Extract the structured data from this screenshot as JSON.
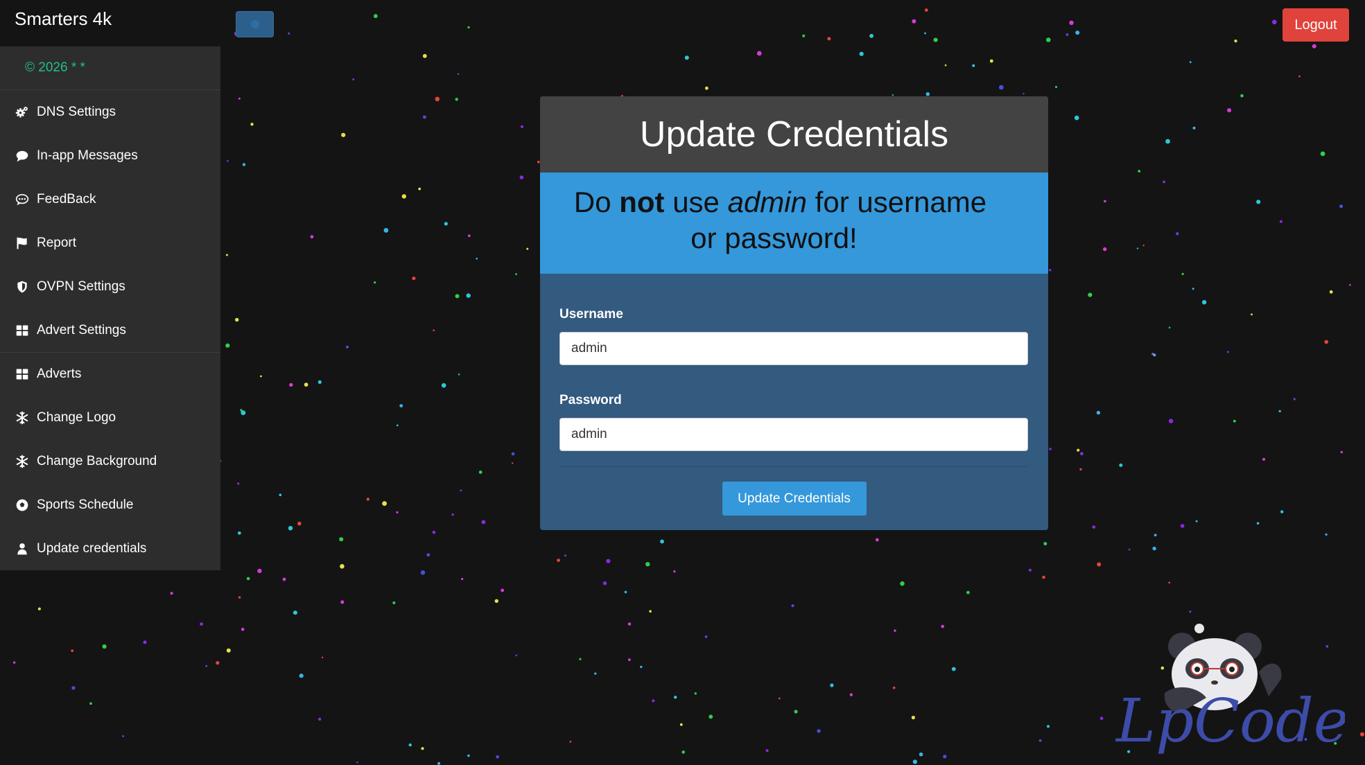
{
  "app": {
    "brand": "Smarters 4k"
  },
  "header": {
    "logout_label": "Logout"
  },
  "sidebar": {
    "copyright": "©  2026 *   *",
    "items": [
      {
        "label": "DNS Settings",
        "icon": "cogs-icon"
      },
      {
        "label": "In-app Messages",
        "icon": "comment-icon"
      },
      {
        "label": "FeedBack",
        "icon": "comment-dots-icon"
      },
      {
        "label": "Report",
        "icon": "flag-icon"
      },
      {
        "label": "OVPN Settings",
        "icon": "shield-icon"
      },
      {
        "label": "Advert Settings",
        "icon": "th-large-icon"
      },
      {
        "label": "Adverts",
        "icon": "th-large-icon"
      },
      {
        "label": "Change Logo",
        "icon": "snowflake-icon"
      },
      {
        "label": "Change Background",
        "icon": "snowflake-icon"
      },
      {
        "label": "Sports Schedule",
        "icon": "futbol-icon"
      },
      {
        "label": "Update credentials",
        "icon": "user-icon"
      }
    ]
  },
  "card": {
    "title": "Update Credentials",
    "warning": {
      "part1": "Do ",
      "bold": "not",
      "part2": " use ",
      "italic": "admin",
      "part3": " for username",
      "line2": "or password!"
    },
    "username_label": "Username",
    "username_value": "admin",
    "password_label": "Password",
    "password_value": "admin",
    "submit_label": "Update Credentials"
  },
  "watermark": {
    "text": "LpCodes"
  },
  "colors": {
    "background": "#141414",
    "sidebar": "#2d2d2d",
    "accent": "#3498db",
    "card_body": "#335a7f",
    "logout": "#e0433b",
    "copyright_text": "#1fbf8f"
  }
}
